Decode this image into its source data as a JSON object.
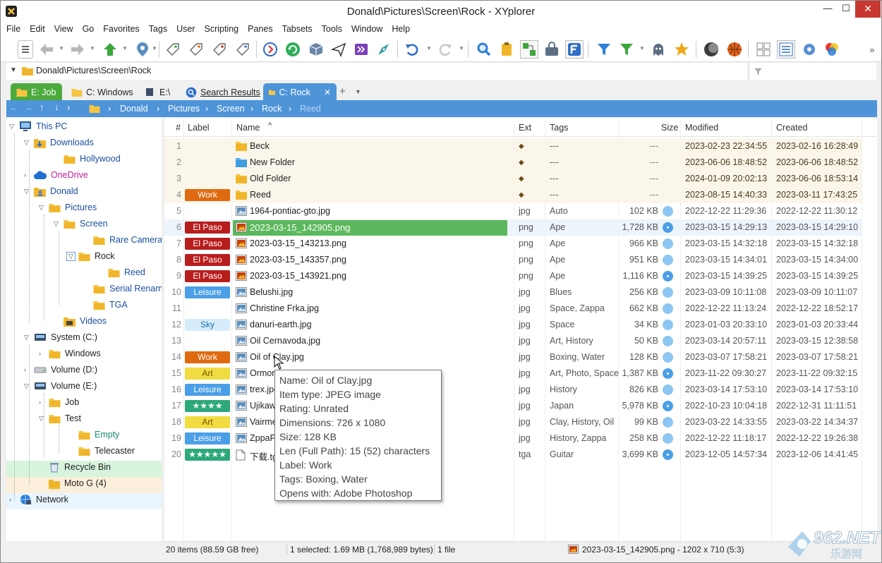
{
  "window": {
    "title": "Donald\\Pictures\\Screen\\Rock - XYplorer",
    "min": "—",
    "max": "☐",
    "close": "✕"
  },
  "menu": [
    "File",
    "Edit",
    "View",
    "Go",
    "Favorites",
    "Tags",
    "User",
    "Scripting",
    "Panes",
    "Tabsets",
    "Tools",
    "Window",
    "Help"
  ],
  "address": {
    "path": "Donald\\Pictures\\Screen\\Rock"
  },
  "tabs": [
    {
      "label": "E: Job"
    },
    {
      "label": "C: Windows"
    },
    {
      "label": "E:\\"
    },
    {
      "label": "Search Results"
    },
    {
      "label": "C: Rock"
    }
  ],
  "breadcrumb": [
    "Donald",
    "Pictures",
    "Screen",
    "Rock",
    "Reed"
  ],
  "tree": [
    {
      "label": "This PC",
      "color": "#1a4fa0"
    },
    {
      "label": "Downloads",
      "color": "#1a4fa0"
    },
    {
      "label": "Hollywood",
      "color": "#1a4fa0"
    },
    {
      "label": "OneDrive",
      "color": "#c0219b"
    },
    {
      "label": "Donald",
      "color": "#1a4fa0"
    },
    {
      "label": "Pictures",
      "color": "#1a4fa0"
    },
    {
      "label": "Screen",
      "color": "#1a4fa0"
    },
    {
      "label": "Rare Cameras",
      "color": "#1a4fa0"
    },
    {
      "label": "Rock",
      "color": "#222"
    },
    {
      "label": "Reed",
      "color": "#1a4fa0"
    },
    {
      "label": "Serial Rename",
      "color": "#1a4fa0"
    },
    {
      "label": "TGA",
      "color": "#1a4fa0"
    },
    {
      "label": "Videos",
      "color": "#1a4fa0"
    },
    {
      "label": "System (C:)",
      "color": "#222"
    },
    {
      "label": "Windows",
      "color": "#222"
    },
    {
      "label": "Volume (D:)",
      "color": "#222"
    },
    {
      "label": "Volume (E:)",
      "color": "#222"
    },
    {
      "label": "Job",
      "color": "#222"
    },
    {
      "label": "Test",
      "color": "#222"
    },
    {
      "label": "Empty",
      "color": "#1a8a7a"
    },
    {
      "label": "Telecaster",
      "color": "#222"
    },
    {
      "label": "Recycle Bin",
      "color": "#222"
    },
    {
      "label": "Moto G (4)",
      "color": "#222"
    },
    {
      "label": "Network",
      "color": "#222"
    }
  ],
  "columns": {
    "num": "#",
    "label": "Label",
    "name": "Name",
    "ext": "Ext",
    "tags": "Tags",
    "size": "Size",
    "modified": "Modified",
    "created": "Created"
  },
  "files": [
    {
      "n": "1",
      "label": "",
      "name": "Beck",
      "ext": "◆",
      "tags": "---",
      "size": "---",
      "mod": "2023-02-23 22:34:55",
      "cre": "2023-02-16 16:28:49",
      "type": "folder",
      "dot": ""
    },
    {
      "n": "2",
      "label": "",
      "name": "New Folder",
      "ext": "◆",
      "tags": "---",
      "size": "---",
      "mod": "2023-06-06 18:48:52",
      "cre": "2023-06-06 18:48:52",
      "type": "folder-blue",
      "dot": ""
    },
    {
      "n": "3",
      "label": "",
      "name": "Old Folder",
      "ext": "◆",
      "tags": "---",
      "size": "---",
      "mod": "2024-01-09 20:02:13",
      "cre": "2023-06-06 18:53:14",
      "type": "folder",
      "dot": ""
    },
    {
      "n": "4",
      "label": "Work",
      "name": "Reed",
      "ext": "◆",
      "tags": "---",
      "size": "---",
      "mod": "2023-08-15 14:40:33",
      "cre": "2023-03-11 17:43:25",
      "type": "folder",
      "dot": ""
    },
    {
      "n": "5",
      "label": "",
      "name": "1964-pontiac-gto.jpg",
      "ext": "jpg",
      "tags": "Auto",
      "size": "102 KB",
      "mod": "2022-12-22 11:29:36",
      "cre": "2022-12-22 11:30:12",
      "type": "img",
      "dot": "plain"
    },
    {
      "n": "6",
      "label": "El Paso",
      "name": "2023-03-15_142905.png",
      "ext": "png",
      "tags": "Ape",
      "size": "1,728 KB",
      "mod": "2023-03-15 14:29:13",
      "cre": "2023-03-15 14:29:10",
      "type": "png",
      "dot": "opt"
    },
    {
      "n": "7",
      "label": "El Paso",
      "name": "2023-03-15_143213.png",
      "ext": "png",
      "tags": "Ape",
      "size": "966 KB",
      "mod": "2023-03-15 14:32:18",
      "cre": "2023-03-15 14:32:18",
      "type": "png",
      "dot": "plain"
    },
    {
      "n": "8",
      "label": "El Paso",
      "name": "2023-03-15_143357.png",
      "ext": "png",
      "tags": "Ape",
      "size": "951 KB",
      "mod": "2023-03-15 14:34:01",
      "cre": "2023-03-15 14:34:00",
      "type": "png",
      "dot": "plain"
    },
    {
      "n": "9",
      "label": "El Paso",
      "name": "2023-03-15_143921.png",
      "ext": "png",
      "tags": "Ape",
      "size": "1,116 KB",
      "mod": "2023-03-15 14:39:25",
      "cre": "2023-03-15 14:39:25",
      "type": "png",
      "dot": "opt"
    },
    {
      "n": "10",
      "label": "Leisure",
      "name": "Belushi.jpg",
      "ext": "jpg",
      "tags": "Blues",
      "size": "256 KB",
      "mod": "2023-03-09 10:11:08",
      "cre": "2023-03-09 10:11:07",
      "type": "img",
      "dot": "plain"
    },
    {
      "n": "11",
      "label": "",
      "name": "Christine Frka.jpg",
      "ext": "jpg",
      "tags": "Space, Zappa",
      "size": "662 KB",
      "mod": "2022-12-22 11:13:24",
      "cre": "2022-12-22 18:52:17",
      "type": "img",
      "dot": "plain"
    },
    {
      "n": "12",
      "label": "Sky",
      "name": "danuri-earth.jpg",
      "ext": "jpg",
      "tags": "Space",
      "size": "34 KB",
      "mod": "2023-01-03 20:33:10",
      "cre": "2023-01-03 20:33:44",
      "type": "img",
      "dot": "plain"
    },
    {
      "n": "13",
      "label": "",
      "name": "Oil Cernavoda.jpg",
      "ext": "jpg",
      "tags": "Art, History",
      "size": "50 KB",
      "mod": "2023-03-14 20:57:11",
      "cre": "2023-03-15 12:38:58",
      "type": "img",
      "dot": "plain"
    },
    {
      "n": "14",
      "label": "Work",
      "name": "Oil of Clay.jpg",
      "ext": "jpg",
      "tags": "Boxing, Water",
      "size": "128 KB",
      "mod": "2023-03-07 17:58:21",
      "cre": "2023-03-07 17:58:21",
      "type": "img",
      "dot": "plain"
    },
    {
      "n": "15",
      "label": "Art",
      "name": "Ormor",
      "ext": "jpg",
      "tags": "Art, Photo, Space",
      "size": "1,387 KB",
      "mod": "2023-11-22 09:30:27",
      "cre": "2023-11-22 09:32:15",
      "type": "img",
      "dot": "opt"
    },
    {
      "n": "16",
      "label": "Leisure",
      "name": "trex.jpg",
      "ext": "jpg",
      "tags": "History",
      "size": "826 KB",
      "mod": "2023-03-14 17:53:10",
      "cre": "2023-03-14 17:53:10",
      "type": "img",
      "dot": "plain"
    },
    {
      "n": "17",
      "label": "★★★★",
      "name": "Ujikaw",
      "ext": "jpg",
      "tags": "Japan",
      "size": "5,978 KB",
      "mod": "2022-10-23 10:04:18",
      "cre": "2022-12-31 11:11:51",
      "type": "img",
      "dot": "opt"
    },
    {
      "n": "18",
      "label": "Art",
      "name": "Vairme",
      "ext": "jpg",
      "tags": "Clay, History, Oil",
      "size": "99 KB",
      "mod": "2023-03-22 14:33:55",
      "cre": "2023-03-22 14:34:37",
      "type": "img",
      "dot": "plain"
    },
    {
      "n": "19",
      "label": "Leisure",
      "name": "ZppaFi",
      "ext": "jpg",
      "tags": "History, Zappa",
      "size": "258 KB",
      "mod": "2022-12-22 11:18:17",
      "cre": "2022-12-22 19:26:38",
      "type": "img",
      "dot": "plain"
    },
    {
      "n": "20",
      "label": "★★★★★",
      "name": "下载.tg",
      "ext": "tga",
      "tags": "Guitar",
      "size": "3,699 KB",
      "mod": "2023-12-05 14:57:34",
      "cre": "2023-12-06 14:41:45",
      "type": "doc",
      "dot": "opt"
    }
  ],
  "labels": {
    "Work": {
      "bg": "#e06a10",
      "fg": "#ffffff"
    },
    "El Paso": {
      "bg": "#b81d1d",
      "fg": "#ffffff"
    },
    "Leisure": {
      "bg": "#4a9fe6",
      "fg": "#ffffff"
    },
    "Sky": {
      "bg": "#d6ecfb",
      "fg": "#1a6db0"
    },
    "Art": {
      "bg": "#f0dc40",
      "fg": "#7a5200"
    },
    "★★★★": {
      "bg": "#2da87a",
      "fg": "#ffffff"
    },
    "★★★★★": {
      "bg": "#2da87a",
      "fg": "#ffffff"
    }
  },
  "tooltip": [
    "Name: Oil of Clay.jpg",
    "Item type: JPEG image",
    "Rating: Unrated",
    "Dimensions: 726 x 1080",
    "Size: 128 KB",
    "Len (Full Path): 15 (52) characters",
    "Label: Work",
    "Tags: Boxing, Water",
    "Opens with: Adobe Photoshop"
  ],
  "status": {
    "items": "20 items (88.59 GB free)",
    "selected": "1 selected: 1.69 MB (1,768,989 bytes)",
    "files": "1 file",
    "preview": "2023-03-15_142905.png - 1202 x 710 (5:3)"
  },
  "watermark": {
    "brand": "962.NET",
    "sub": "乐游网"
  },
  "colors": {
    "accent": "#4e94d9",
    "selected_row": "#5cb85c",
    "folder": "#f5c542",
    "folder_row": "#fbf6ea"
  }
}
